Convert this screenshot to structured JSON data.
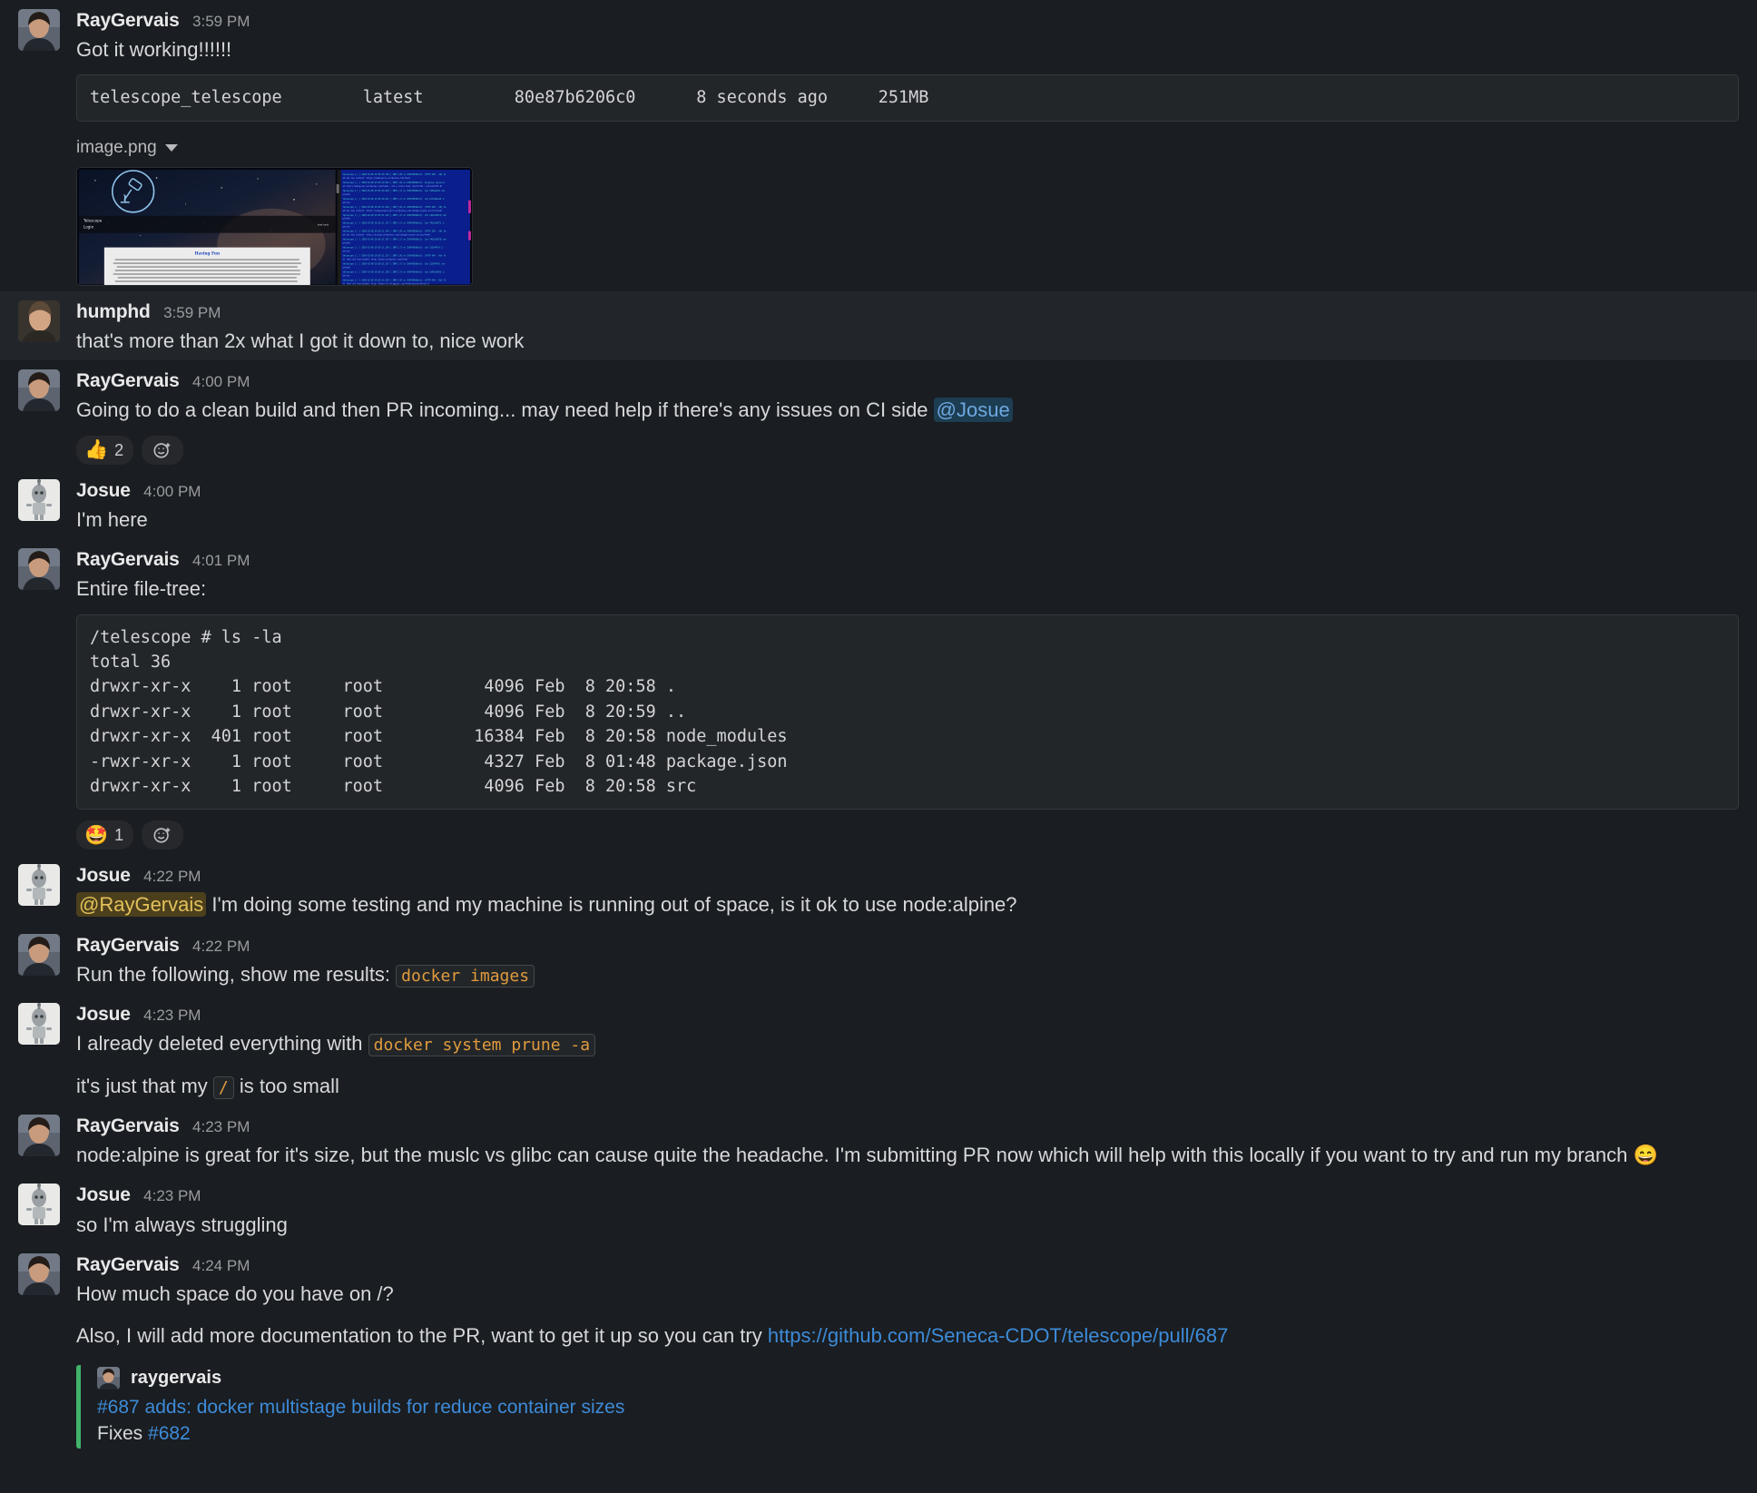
{
  "colors": {
    "background": "#1a1d21",
    "background_highlight": "#22262b",
    "text": "#d7d8da",
    "link": "#3d8bd8",
    "mention": "#6ea8e0",
    "mention_self": "#e3c15b",
    "inline_code": "#e09b3d",
    "attachment_accent": "#41b36a"
  },
  "messages": [
    {
      "id": "m1",
      "author": "RayGervais",
      "time": "3:59 PM",
      "text": "Got it working!!!!!!",
      "codeblock": "telescope_telescope        latest         80e87b6206c0      8 seconds ago     251MB",
      "code_columns": [
        "telescope_telescope",
        "latest",
        "80e87b6206c0",
        "8 seconds ago",
        "251MB"
      ],
      "attachment_filename": "image.png"
    },
    {
      "id": "m2",
      "author": "humphd",
      "time": "3:59 PM",
      "text": "that's more than 2x what I got it down to, nice work"
    },
    {
      "id": "m3",
      "author": "RayGervais",
      "time": "4:00 PM",
      "text_before": "Going to do a clean build and then PR incoming... may need help if there's any issues on CI side ",
      "mention": "@Josue",
      "reaction_emoji": "thumbsup-emoji",
      "reaction_glyph": "👍",
      "reaction_count": "2",
      "add_reaction_label": "add-reaction"
    },
    {
      "id": "m4",
      "author": "Josue",
      "time": "4:00 PM",
      "text": "I'm here"
    },
    {
      "id": "m5",
      "author": "RayGervais",
      "time": "4:01 PM",
      "text": "Entire file-tree:",
      "codeblock": "/telescope # ls -la\ntotal 36\ndrwxr-xr-x    1 root     root          4096 Feb  8 20:58 .\ndrwxr-xr-x    1 root     root          4096 Feb  8 20:59 ..\ndrwxr-xr-x  401 root     root         16384 Feb  8 20:58 node_modules\n-rwxr-xr-x    1 root     root          4327 Feb  8 01:48 package.json\ndrwxr-xr-x    1 root     root          4096 Feb  8 20:58 src",
      "reaction_emoji": "star-struck-emoji",
      "reaction_glyph": "🤩",
      "reaction_count": "1",
      "add_reaction_label": "add-reaction"
    },
    {
      "id": "m6",
      "author": "Josue",
      "time": "4:22 PM",
      "mention_self": "@RayGervais",
      "text_after": " I'm doing some testing and my machine is running out of space, is it ok to use node:alpine?"
    },
    {
      "id": "m7",
      "author": "RayGervais",
      "time": "4:22 PM",
      "text_before": "Run the following, show me results: ",
      "inline_code": "docker images"
    },
    {
      "id": "m8",
      "author": "Josue",
      "time": "4:23 PM",
      "text_before": "I already deleted everything with ",
      "inline_code": "docker system prune -a",
      "line2_before": "it's just that my ",
      "line2_code": "/",
      "line2_after": " is too small"
    },
    {
      "id": "m9",
      "author": "RayGervais",
      "time": "4:23 PM",
      "text": "node:alpine is great for it's size, but the muslc vs glibc can cause quite the headache. I'm submitting PR now which will help with this locally if you want to try and run my branch ",
      "trailing_emoji": "😄",
      "trailing_emoji_name": "grinning-squinting-face-emoji"
    },
    {
      "id": "m10",
      "author": "Josue",
      "time": "4:23 PM",
      "text": "so I'm always struggling"
    },
    {
      "id": "m11",
      "author": "RayGervais",
      "time": "4:24 PM",
      "text": "How much space do you have on /?",
      "line2_before": "Also, I will add more documentation to the PR, want to get it up so you can try ",
      "line2_link": "https://github.com/Seneca-CDOT/telescope/pull/687",
      "attachment": {
        "author": "raygervais",
        "title": "#687 adds: docker multistage builds for reduce container sizes",
        "body_before": "Fixes ",
        "body_link": "#682"
      }
    }
  ]
}
